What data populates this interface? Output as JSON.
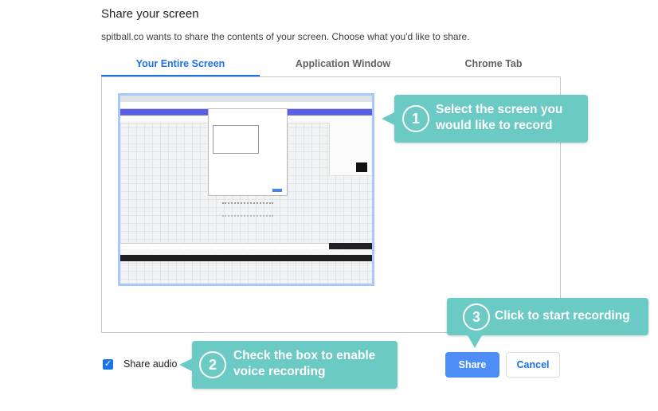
{
  "dialog": {
    "title": "Share your screen",
    "subtitle": "spitball.co  wants to share the contents of your screen. Choose what you'd like to share."
  },
  "tabs": [
    {
      "label": "Your Entire Screen",
      "active": true
    },
    {
      "label": "Application Window",
      "active": false
    },
    {
      "label": "Chrome Tab",
      "active": false
    }
  ],
  "callouts": [
    {
      "number": "1",
      "text": "Select the screen you would like to record"
    },
    {
      "number": "2",
      "text": "Check the box to enable voice recording"
    },
    {
      "number": "3",
      "text": "Click to start recording"
    }
  ],
  "audio": {
    "label": "Share audio",
    "checked": true
  },
  "buttons": {
    "share": "Share",
    "cancel": "Cancel"
  },
  "colors": {
    "accent": "#1a73e8",
    "callout": "#6ccac4",
    "share_button": "#4c8ef5"
  }
}
